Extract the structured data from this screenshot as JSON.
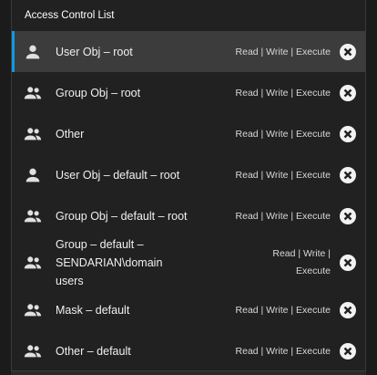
{
  "header": {
    "title": "Access Control List"
  },
  "entries": [
    {
      "name": "User Obj – root",
      "permissions": "Read | Write | Execute",
      "icon": "person-icon",
      "selected": true
    },
    {
      "name": "Group Obj – root",
      "permissions": "Read | Write | Execute",
      "icon": "group-icon"
    },
    {
      "name": "Other",
      "permissions": "Read | Write | Execute",
      "icon": "group-icon"
    },
    {
      "name": "User Obj – default – root",
      "permissions": "Read | Write | Execute",
      "icon": "person-icon"
    },
    {
      "name": "Group Obj – default – root",
      "permissions": "Read | Write | Execute",
      "icon": "group-icon"
    },
    {
      "name": "Group – default – SENDARIAN\\domain users",
      "permissions": "Read | Write | Execute",
      "icon": "group-icon"
    },
    {
      "name": "Mask – default",
      "permissions": "Read | Write | Execute",
      "icon": "group-icon"
    },
    {
      "name": "Other – default",
      "permissions": "Read | Write | Execute",
      "icon": "group-icon"
    }
  ],
  "colors": {
    "accent": "#0e9be0",
    "selected_bg": "#3c3c3c",
    "panel_bg": "#212121"
  }
}
